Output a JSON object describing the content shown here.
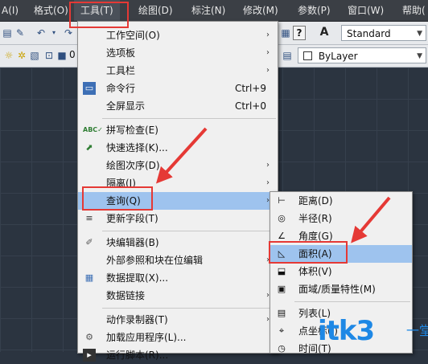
{
  "menubar": {
    "items": [
      "A(I)",
      "格式(O)",
      "工具(T)",
      "绘图(D)",
      "标注(N)",
      "修改(M)",
      "参数(P)",
      "窗口(W)",
      "帮助("
    ],
    "active_index": 2
  },
  "toolbar": {
    "style_combo": "Standard",
    "layer_combo": "ByLayer",
    "layer_value_short": "0",
    "help_button": "?",
    "font_icon": "A"
  },
  "tools_menu": {
    "items": [
      {
        "label": "工作空间(O)",
        "submenu": true
      },
      {
        "label": "选项板",
        "submenu": true
      },
      {
        "label": "工具栏",
        "submenu": true
      },
      {
        "label": "命令行",
        "shortcut": "Ctrl+9",
        "icon": "command-line-icon"
      },
      {
        "label": "全屏显示",
        "shortcut": "Ctrl+0"
      },
      {
        "label": "拼写检查(E)",
        "icon": "spell-check-icon"
      },
      {
        "label": "快速选择(K)...",
        "icon": "quick-select-icon"
      },
      {
        "label": "绘图次序(D)",
        "submenu": true
      },
      {
        "label": "隔离(I)",
        "submenu": true
      },
      {
        "label": "查询(Q)",
        "submenu": true,
        "highlighted": true
      },
      {
        "label": "更新字段(T)",
        "icon": "update-field-icon"
      },
      {
        "label": "块编辑器(B)",
        "icon": "block-editor-icon"
      },
      {
        "label": "外部参照和块在位编辑",
        "submenu": true
      },
      {
        "label": "数据提取(X)...",
        "icon": "data-extraction-icon"
      },
      {
        "label": "数据链接",
        "submenu": true
      },
      {
        "label": "动作录制器(T)",
        "submenu": true
      },
      {
        "label": "加载应用程序(L)...",
        "icon": "load-app-icon"
      },
      {
        "label": "运行脚本(R)...",
        "icon": "script-icon"
      }
    ]
  },
  "inquiry_submenu": {
    "items": [
      {
        "label": "距离(D)",
        "icon": "distance-icon"
      },
      {
        "label": "半径(R)",
        "icon": "radius-icon"
      },
      {
        "label": "角度(G)",
        "icon": "angle-icon"
      },
      {
        "label": "面积(A)",
        "icon": "area-icon",
        "highlighted": true
      },
      {
        "label": "体积(V)",
        "icon": "volume-icon"
      },
      {
        "label": "面域/质量特性(M)",
        "icon": "mass-properties-icon"
      },
      {
        "label": "列表(L)",
        "icon": "list-icon"
      },
      {
        "label": "点坐标(I)",
        "icon": "id-point-icon"
      },
      {
        "label": "时间(T)",
        "icon": "time-icon"
      }
    ]
  },
  "watermark": {
    "main": "itk3",
    "side": "一堂课"
  },
  "colors": {
    "highlight": "#9ec3ee",
    "annotation_red": "#e53935",
    "watermark_blue": "#1e88e5"
  }
}
